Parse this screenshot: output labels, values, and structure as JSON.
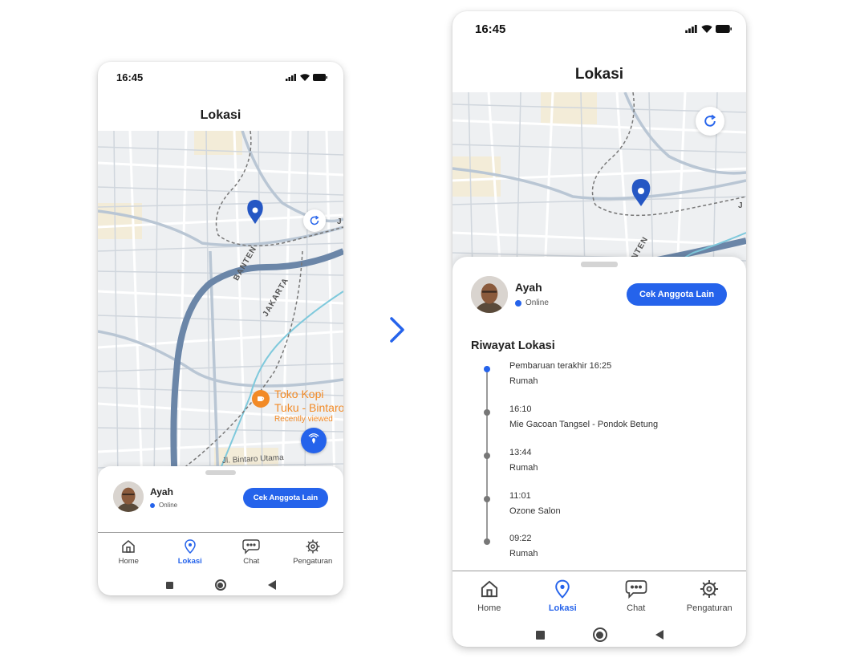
{
  "colors": {
    "accent": "#2563eb",
    "poi": "#f28a26",
    "river": "#6b86a8"
  },
  "status_bar": {
    "time": "16:45"
  },
  "header": {
    "title": "Lokasi"
  },
  "map": {
    "poi": {
      "line1": "Toko Kopi",
      "line2": "Tuku - Bintaro",
      "sub": "Recently viewed"
    },
    "roads": {
      "banten": "BANTEN",
      "jakarta": "JAKARTA",
      "bintaro": "Jl. Bintaro Utama",
      "j": "J"
    },
    "refresh_icon": "refresh-icon",
    "geofence_icon": "geofence-icon"
  },
  "member": {
    "name": "Ayah",
    "status": "Online"
  },
  "buttons": {
    "cek": "Cek Anggota Lain"
  },
  "history": {
    "title": "Riwayat Lokasi",
    "items": [
      {
        "time": "Pembaruan terakhir 16:25",
        "place": "Rumah",
        "active": true
      },
      {
        "time": "16:10",
        "place": "Mie Gacoan Tangsel - Pondok Betung"
      },
      {
        "time": "13:44",
        "place": "Rumah"
      },
      {
        "time": "11:01",
        "place": "Ozone Salon"
      },
      {
        "time": "09:22",
        "place": "Rumah"
      }
    ]
  },
  "nav": {
    "items": [
      {
        "label": "Home",
        "icon": "home-icon"
      },
      {
        "label": "Lokasi",
        "icon": "location-icon",
        "active": true
      },
      {
        "label": "Chat",
        "icon": "chat-icon"
      },
      {
        "label": "Pengaturan",
        "icon": "settings-icon"
      }
    ]
  }
}
